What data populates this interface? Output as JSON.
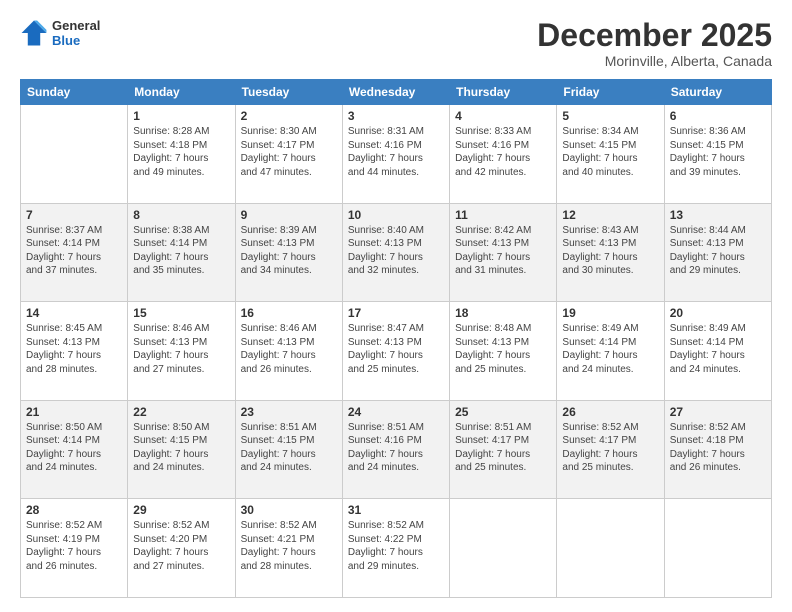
{
  "header": {
    "logo_line1": "General",
    "logo_line2": "Blue",
    "title": "December 2025",
    "subtitle": "Morinville, Alberta, Canada"
  },
  "weekdays": [
    "Sunday",
    "Monday",
    "Tuesday",
    "Wednesday",
    "Thursday",
    "Friday",
    "Saturday"
  ],
  "weeks": [
    [
      {
        "day": "",
        "detail": ""
      },
      {
        "day": "1",
        "detail": "Sunrise: 8:28 AM\nSunset: 4:18 PM\nDaylight: 7 hours\nand 49 minutes."
      },
      {
        "day": "2",
        "detail": "Sunrise: 8:30 AM\nSunset: 4:17 PM\nDaylight: 7 hours\nand 47 minutes."
      },
      {
        "day": "3",
        "detail": "Sunrise: 8:31 AM\nSunset: 4:16 PM\nDaylight: 7 hours\nand 44 minutes."
      },
      {
        "day": "4",
        "detail": "Sunrise: 8:33 AM\nSunset: 4:16 PM\nDaylight: 7 hours\nand 42 minutes."
      },
      {
        "day": "5",
        "detail": "Sunrise: 8:34 AM\nSunset: 4:15 PM\nDaylight: 7 hours\nand 40 minutes."
      },
      {
        "day": "6",
        "detail": "Sunrise: 8:36 AM\nSunset: 4:15 PM\nDaylight: 7 hours\nand 39 minutes."
      }
    ],
    [
      {
        "day": "7",
        "detail": "Sunrise: 8:37 AM\nSunset: 4:14 PM\nDaylight: 7 hours\nand 37 minutes."
      },
      {
        "day": "8",
        "detail": "Sunrise: 8:38 AM\nSunset: 4:14 PM\nDaylight: 7 hours\nand 35 minutes."
      },
      {
        "day": "9",
        "detail": "Sunrise: 8:39 AM\nSunset: 4:13 PM\nDaylight: 7 hours\nand 34 minutes."
      },
      {
        "day": "10",
        "detail": "Sunrise: 8:40 AM\nSunset: 4:13 PM\nDaylight: 7 hours\nand 32 minutes."
      },
      {
        "day": "11",
        "detail": "Sunrise: 8:42 AM\nSunset: 4:13 PM\nDaylight: 7 hours\nand 31 minutes."
      },
      {
        "day": "12",
        "detail": "Sunrise: 8:43 AM\nSunset: 4:13 PM\nDaylight: 7 hours\nand 30 minutes."
      },
      {
        "day": "13",
        "detail": "Sunrise: 8:44 AM\nSunset: 4:13 PM\nDaylight: 7 hours\nand 29 minutes."
      }
    ],
    [
      {
        "day": "14",
        "detail": "Sunrise: 8:45 AM\nSunset: 4:13 PM\nDaylight: 7 hours\nand 28 minutes."
      },
      {
        "day": "15",
        "detail": "Sunrise: 8:46 AM\nSunset: 4:13 PM\nDaylight: 7 hours\nand 27 minutes."
      },
      {
        "day": "16",
        "detail": "Sunrise: 8:46 AM\nSunset: 4:13 PM\nDaylight: 7 hours\nand 26 minutes."
      },
      {
        "day": "17",
        "detail": "Sunrise: 8:47 AM\nSunset: 4:13 PM\nDaylight: 7 hours\nand 25 minutes."
      },
      {
        "day": "18",
        "detail": "Sunrise: 8:48 AM\nSunset: 4:13 PM\nDaylight: 7 hours\nand 25 minutes."
      },
      {
        "day": "19",
        "detail": "Sunrise: 8:49 AM\nSunset: 4:14 PM\nDaylight: 7 hours\nand 24 minutes."
      },
      {
        "day": "20",
        "detail": "Sunrise: 8:49 AM\nSunset: 4:14 PM\nDaylight: 7 hours\nand 24 minutes."
      }
    ],
    [
      {
        "day": "21",
        "detail": "Sunrise: 8:50 AM\nSunset: 4:14 PM\nDaylight: 7 hours\nand 24 minutes."
      },
      {
        "day": "22",
        "detail": "Sunrise: 8:50 AM\nSunset: 4:15 PM\nDaylight: 7 hours\nand 24 minutes."
      },
      {
        "day": "23",
        "detail": "Sunrise: 8:51 AM\nSunset: 4:15 PM\nDaylight: 7 hours\nand 24 minutes."
      },
      {
        "day": "24",
        "detail": "Sunrise: 8:51 AM\nSunset: 4:16 PM\nDaylight: 7 hours\nand 24 minutes."
      },
      {
        "day": "25",
        "detail": "Sunrise: 8:51 AM\nSunset: 4:17 PM\nDaylight: 7 hours\nand 25 minutes."
      },
      {
        "day": "26",
        "detail": "Sunrise: 8:52 AM\nSunset: 4:17 PM\nDaylight: 7 hours\nand 25 minutes."
      },
      {
        "day": "27",
        "detail": "Sunrise: 8:52 AM\nSunset: 4:18 PM\nDaylight: 7 hours\nand 26 minutes."
      }
    ],
    [
      {
        "day": "28",
        "detail": "Sunrise: 8:52 AM\nSunset: 4:19 PM\nDaylight: 7 hours\nand 26 minutes."
      },
      {
        "day": "29",
        "detail": "Sunrise: 8:52 AM\nSunset: 4:20 PM\nDaylight: 7 hours\nand 27 minutes."
      },
      {
        "day": "30",
        "detail": "Sunrise: 8:52 AM\nSunset: 4:21 PM\nDaylight: 7 hours\nand 28 minutes."
      },
      {
        "day": "31",
        "detail": "Sunrise: 8:52 AM\nSunset: 4:22 PM\nDaylight: 7 hours\nand 29 minutes."
      },
      {
        "day": "",
        "detail": ""
      },
      {
        "day": "",
        "detail": ""
      },
      {
        "day": "",
        "detail": ""
      }
    ]
  ]
}
